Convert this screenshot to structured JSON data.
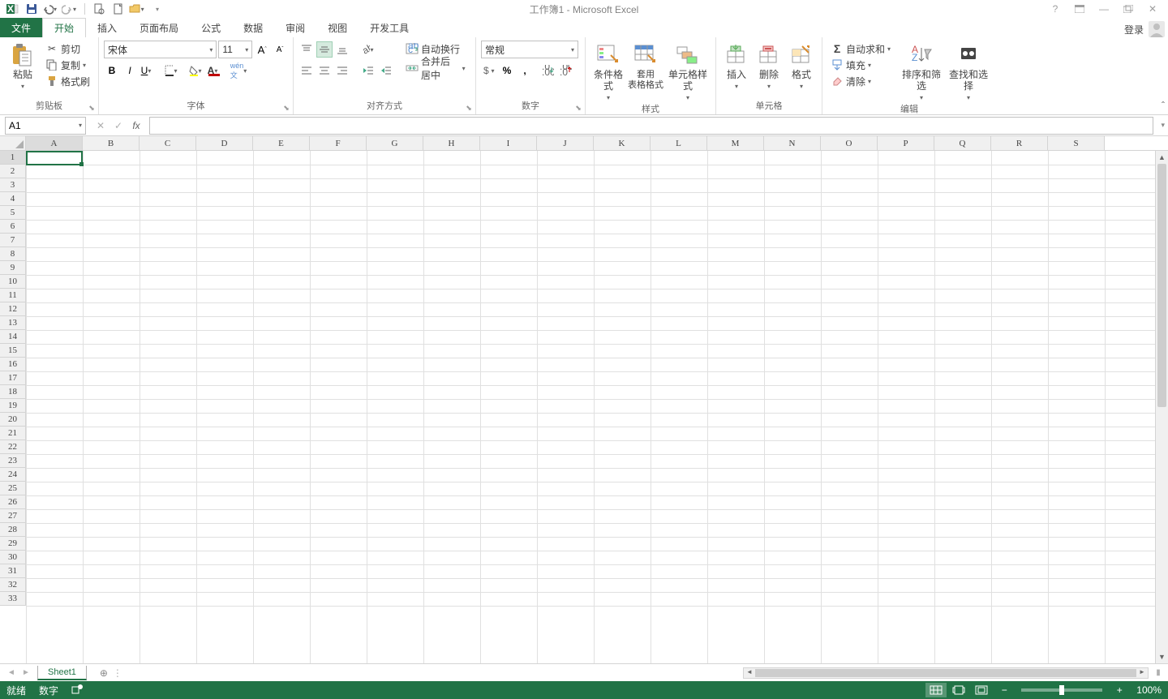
{
  "title": "工作簿1 - Microsoft Excel",
  "tabs": {
    "file": "文件",
    "home": "开始",
    "insert": "插入",
    "layout": "页面布局",
    "formula": "公式",
    "data": "数据",
    "review": "审阅",
    "view": "视图",
    "dev": "开发工具",
    "login": "登录"
  },
  "clipboard": {
    "paste": "粘贴",
    "cut": "剪切",
    "copy": "复制",
    "painter": "格式刷",
    "label": "剪贴板"
  },
  "font": {
    "name": "宋体",
    "size": "11",
    "label": "字体"
  },
  "align": {
    "wrap": "自动换行",
    "merge": "合并后居中",
    "label": "对齐方式"
  },
  "number": {
    "format": "常规",
    "label": "数字"
  },
  "styles": {
    "cond": "条件格式",
    "table": "套用\n表格格式",
    "cell": "单元格样式",
    "label": "样式"
  },
  "cells": {
    "insert": "插入",
    "delete": "删除",
    "format": "格式",
    "label": "单元格"
  },
  "editing": {
    "sum": "自动求和",
    "fill": "填充",
    "clear": "清除",
    "sort": "排序和筛选",
    "find": "查找和选择",
    "label": "编辑"
  },
  "namebox": "A1",
  "sheet": "Sheet1",
  "cols": [
    "A",
    "B",
    "C",
    "D",
    "E",
    "F",
    "G",
    "H",
    "I",
    "J",
    "K",
    "L",
    "M",
    "N",
    "O",
    "P",
    "Q",
    "R",
    "S"
  ],
  "rows": 33,
  "status": {
    "ready": "就绪",
    "num": "数字",
    "zoom": "100%"
  }
}
